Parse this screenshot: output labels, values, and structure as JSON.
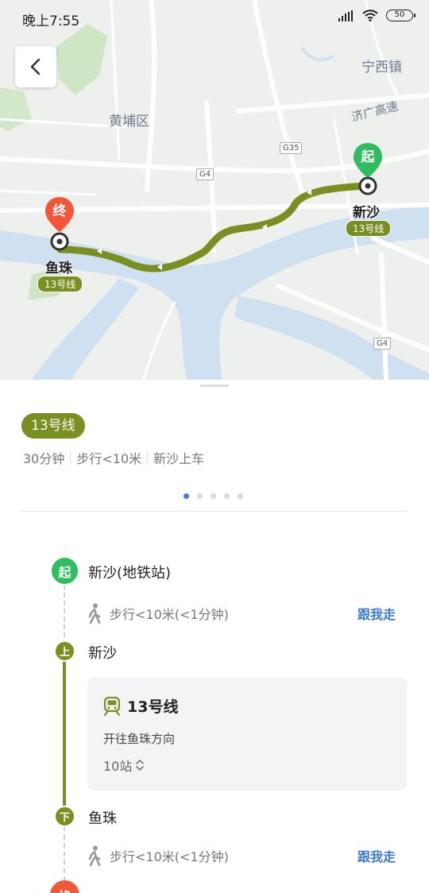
{
  "status_bar": {
    "time": "晚上7:55",
    "battery": "50"
  },
  "map": {
    "labels": {
      "district": "黄埔区",
      "town": "宁西镇",
      "expressway": "济广高速"
    },
    "road_tags": [
      "G35",
      "G4",
      "G4"
    ],
    "start_pin": {
      "glyph": "起",
      "station": "新沙",
      "line": "13号线"
    },
    "end_pin": {
      "glyph": "终",
      "station": "鱼珠",
      "line": "13号线"
    },
    "colors": {
      "route": "#7a8f21",
      "start": "#2fbd5f",
      "end": "#f4563a",
      "water": "#cfe0f1"
    }
  },
  "route": {
    "line_chip": "13号线",
    "duration": "30分钟",
    "walk": "步行<10米",
    "board_at": "新沙上车",
    "pager": {
      "count": 5,
      "active": 0
    }
  },
  "steps": {
    "start": {
      "glyph": "起",
      "title": "新沙(地铁站)"
    },
    "walk1": {
      "text": "步行<10米(<1分钟)",
      "action": "跟我走"
    },
    "board": {
      "glyph": "上",
      "title": "新沙"
    },
    "transit": {
      "line": "13号线",
      "direction": "开往鱼珠方向",
      "stops": "10站"
    },
    "alight": {
      "glyph": "下",
      "title": "鱼珠"
    },
    "walk2": {
      "text": "步行<10米(<1分钟)",
      "action": "跟我走"
    },
    "end": {
      "glyph": "终"
    }
  },
  "icons": [
    "back-arrow-icon",
    "signal-icon",
    "wifi-icon",
    "battery-icon",
    "walk-icon",
    "metro-icon",
    "expand-icon"
  ]
}
